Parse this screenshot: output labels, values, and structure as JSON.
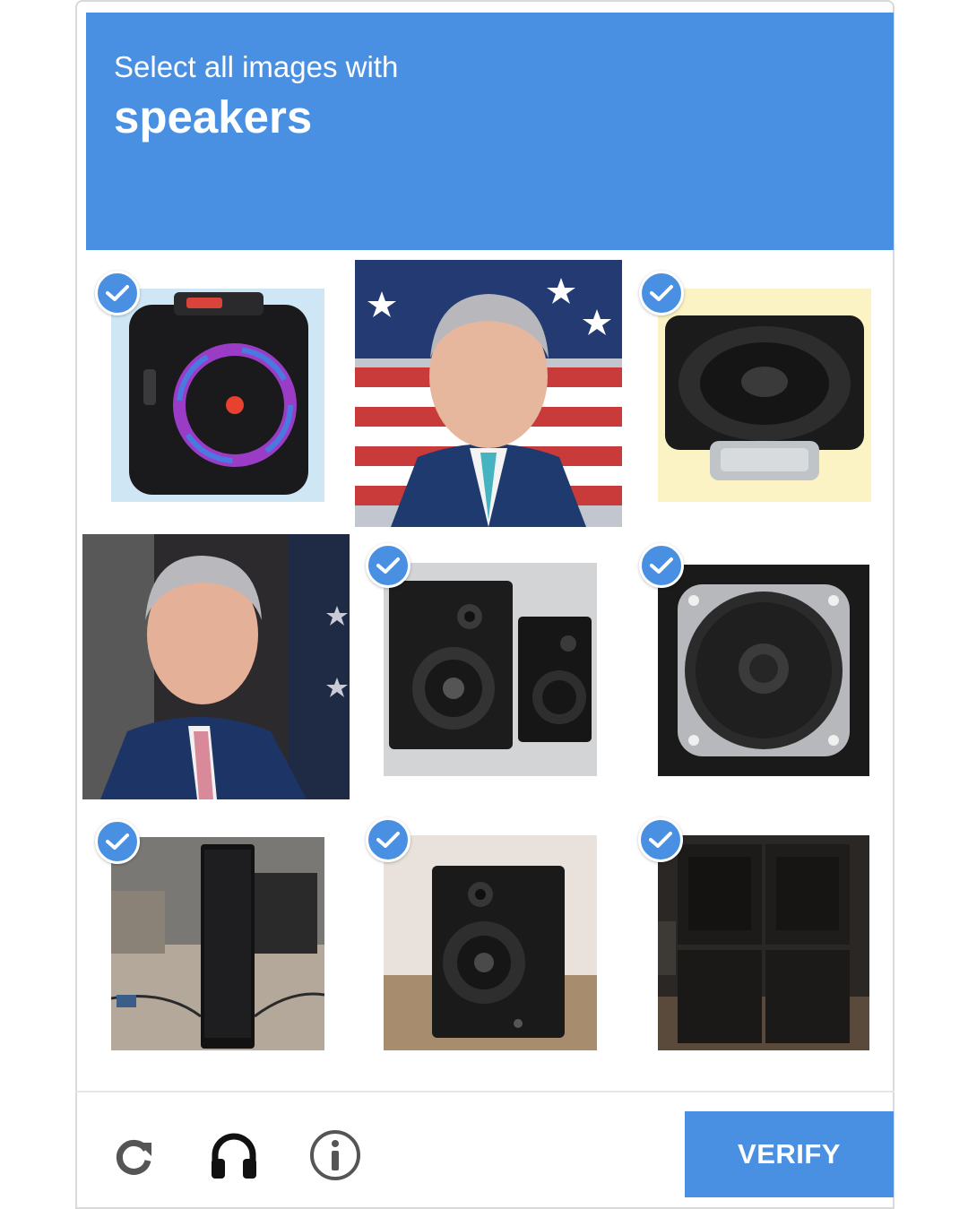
{
  "header": {
    "instruction": "Select all images with",
    "target": "speakers",
    "color": "#4a90e2"
  },
  "tiles": [
    {
      "subject": "portable-party-speaker-photo",
      "selected": true
    },
    {
      "subject": "politician-portrait-photo",
      "selected": false
    },
    {
      "subject": "speaker-driver-photo",
      "selected": true
    },
    {
      "subject": "politician-portrait-photo",
      "selected": false
    },
    {
      "subject": "bookshelf-speakers-photo",
      "selected": true
    },
    {
      "subject": "speaker-driver-photo",
      "selected": true
    },
    {
      "subject": "tower-speaker-photo",
      "selected": true
    },
    {
      "subject": "studio-monitor-photo",
      "selected": true
    },
    {
      "subject": "stacked-pa-speakers-photo",
      "selected": true
    }
  ],
  "footer": {
    "icons": [
      "reload-icon",
      "headphones-icon",
      "info-icon"
    ],
    "verify_label": "VERIFY"
  }
}
